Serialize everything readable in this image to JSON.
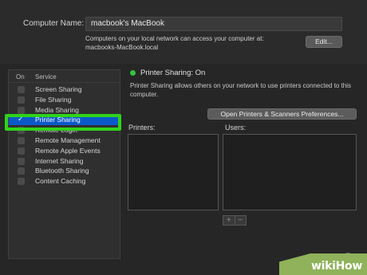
{
  "computer_name": {
    "label": "Computer Name:",
    "value": "macbook's MacBook",
    "note": "Computers on your local network can access your computer at:",
    "address": "macbooks-MacBook.local",
    "edit_label": "Edit..."
  },
  "services": {
    "header_on": "On",
    "header_service": "Service",
    "items": [
      {
        "label": "Screen Sharing",
        "checked": false
      },
      {
        "label": "File Sharing",
        "checked": false
      },
      {
        "label": "Media Sharing",
        "checked": false
      },
      {
        "label": "Printer Sharing",
        "checked": true,
        "selected": true
      },
      {
        "label": "Remote Login",
        "checked": false
      },
      {
        "label": "Remote Management",
        "checked": false
      },
      {
        "label": "Remote Apple Events",
        "checked": false
      },
      {
        "label": "Internet Sharing",
        "checked": false
      },
      {
        "label": "Bluetooth Sharing",
        "checked": false
      },
      {
        "label": "Content Caching",
        "checked": false
      }
    ]
  },
  "detail": {
    "status": "Printer Sharing: On",
    "status_color": "#33c23f",
    "description": "Printer Sharing allows others on your network to use printers connected to this computer.",
    "open_prefs_label": "Open Printers & Scanners Preferences...",
    "printers_label": "Printers:",
    "users_label": "Users:",
    "add_label": "+",
    "remove_label": "−"
  },
  "help_label": "?",
  "watermark": "wikiHow",
  "colors": {
    "selection": "#0a59c9",
    "highlight": "#2fd31a",
    "watermark_bg": "#8fb25a"
  }
}
